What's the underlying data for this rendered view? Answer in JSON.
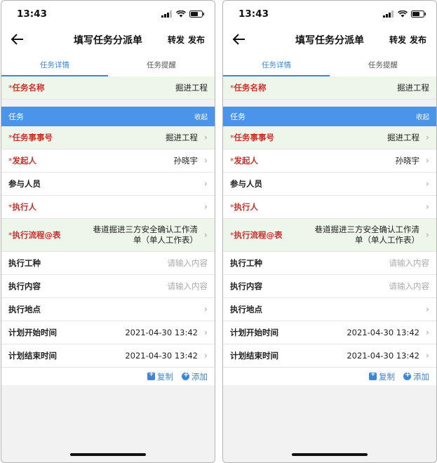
{
  "status_time": "13:43",
  "nav": {
    "title": "填写任务分派单",
    "forward": "转发",
    "publish": "发布"
  },
  "tabs": [
    {
      "label": "任务详情"
    },
    {
      "label": "任务提醒"
    }
  ],
  "task_name": {
    "label": "任务名称",
    "value": "掘进工程"
  },
  "section": {
    "title": "任务",
    "collapse": "收起"
  },
  "fields": [
    {
      "label": "任务事事号",
      "value": "掘进工程"
    },
    {
      "label": "发起人",
      "value": "孙晓宇"
    },
    {
      "label": "参与人员",
      "value": ""
    },
    {
      "label": "执行人",
      "value": ""
    },
    {
      "label": "执行流程@表",
      "value": "巷道掘进三方安全确认工作清单（单人工作表）"
    },
    {
      "label": "执行工种",
      "placeholder": "请输入内容"
    },
    {
      "label": "执行内容",
      "placeholder": "请输入内容"
    },
    {
      "label": "执行地点",
      "value": ""
    },
    {
      "label": "计划开始时间",
      "value": "2021-04-30 13:42"
    },
    {
      "label": "计划结束时间",
      "value": "2021-04-30 13:42"
    }
  ],
  "actions": {
    "copy": "复制",
    "add": "添加"
  },
  "colors": {
    "accent": "#3a86d8",
    "section_bg": "#4a94ea",
    "required": "#c9302c",
    "required_bg": "#eef5ea"
  },
  "icons": {
    "back": "arrow-left-icon",
    "chevron": "chevron-right-icon",
    "copy": "copy-plus-icon",
    "add": "add-circle-icon"
  }
}
